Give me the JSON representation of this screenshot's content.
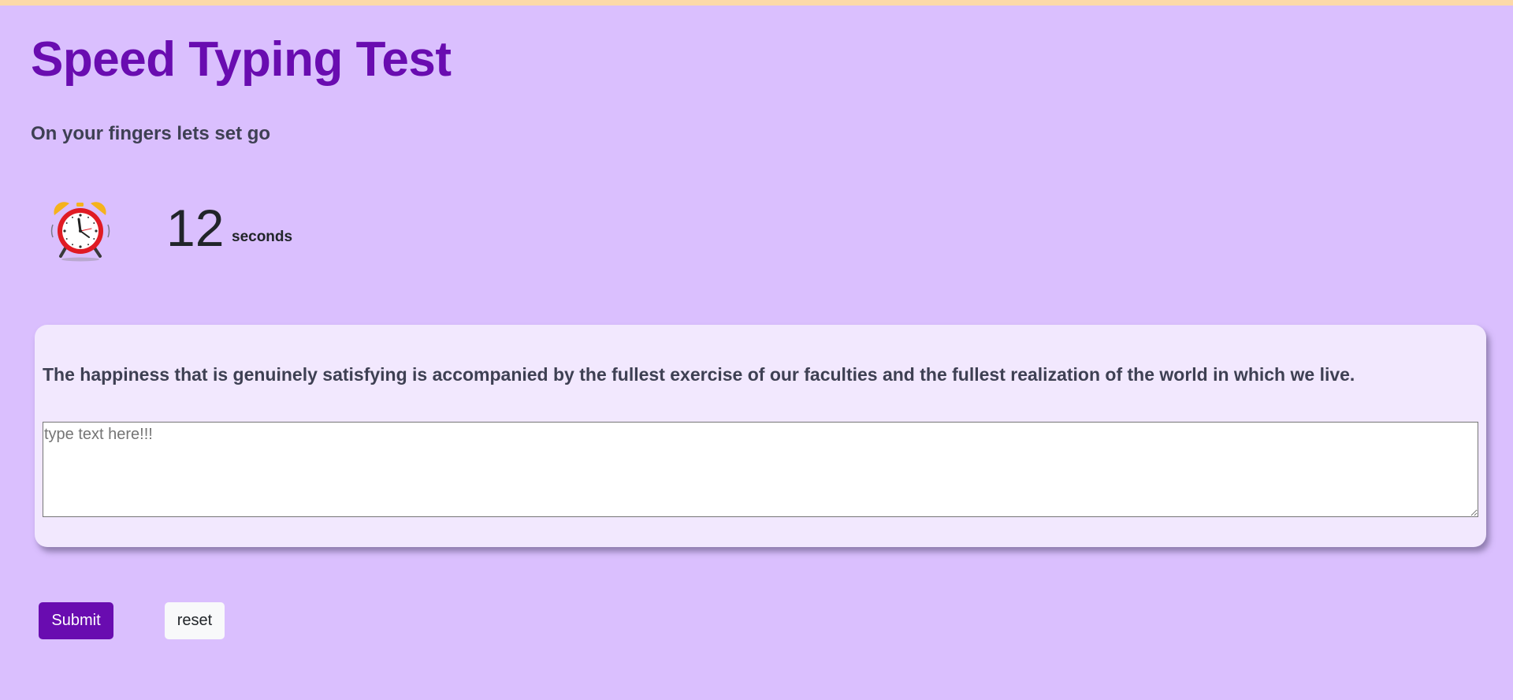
{
  "header": {
    "title": "Speed Typing Test",
    "subtitle": "On your fingers lets set go"
  },
  "timer": {
    "icon": "alarm-clock-icon",
    "value": "12",
    "unit": "seconds"
  },
  "quote": {
    "text": "The happiness that is genuinely satisfying is accompanied by the fullest exercise of our faculties and the fullest realization of the world in which we live."
  },
  "input": {
    "value": "",
    "placeholder": "type text here!!!"
  },
  "actions": {
    "submit_label": "Submit",
    "reset_label": "reset"
  },
  "colors": {
    "page_background": "#dabffe",
    "accent": "#690cb0",
    "card_background": "#f2e8fe",
    "top_strip": "#fcd9a8"
  }
}
